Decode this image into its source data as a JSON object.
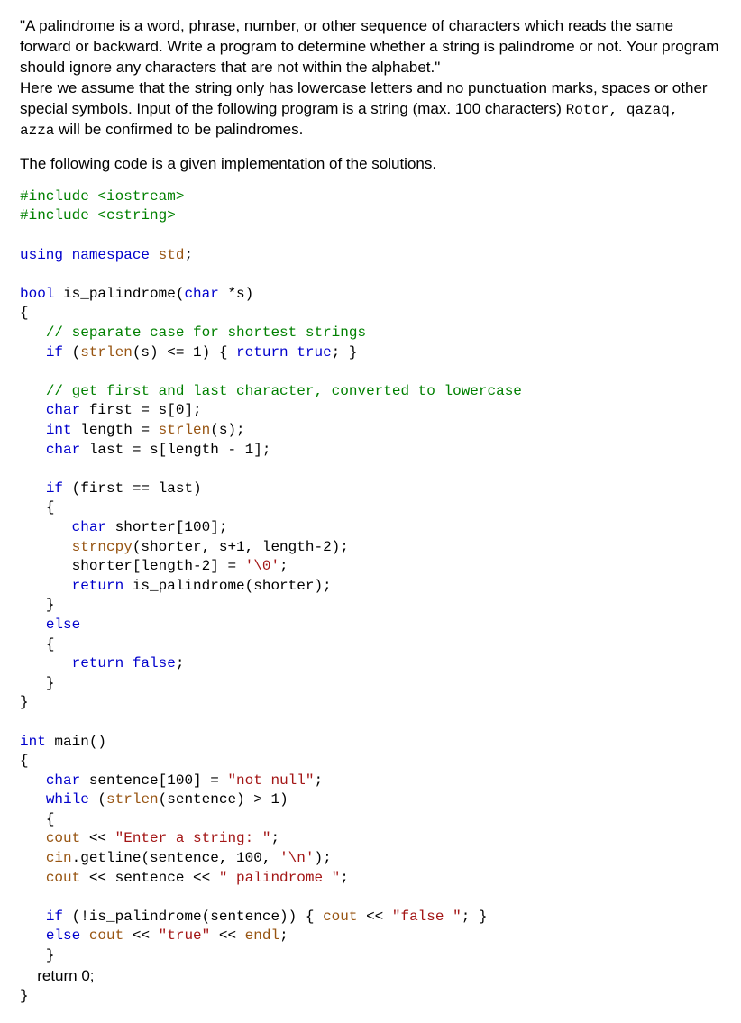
{
  "problem": {
    "quoted": "\"A palindrome is a word, phrase, number, or other sequence of characters which reads the same forward or backward. Write a program to determine whether a string is palindrome or not. Your program should ignore any characters that are not within the alphabet.\"",
    "assumption_pre": "Here we assume that the string only has lowercase letters and no punctuation marks, spaces or other special symbols.  Input of the following program is a string (max. 100 characters) ",
    "examples": "Rotor, qazaq, azza",
    "assumption_post": " will be confirmed to be palindromes.",
    "intro": "The following code is a given implementation of the solutions."
  },
  "code": {
    "inc1a": "#include ",
    "inc1b": "<iostream>",
    "inc2a": "#include ",
    "inc2b": "<cstring>",
    "using1": "using",
    "using2": " namespace ",
    "using3": "std",
    "using4": ";",
    "fn_bool": "bool",
    "fn_name": " is_palindrome",
    "fn_sig_a": "(",
    "fn_char": "char",
    "fn_sig_b": " *s)",
    "lb": "{",
    "rb": "}",
    "cmt1": "// separate case for shortest strings",
    "if1a": "if",
    "if1b": " (",
    "strlen": "strlen",
    "if1c": "(s) <= 1) { ",
    "ret": "return",
    "if1d": " ",
    "true": "true",
    "if1e": "; }",
    "cmt2": "// get first and last character, converted to lowercase",
    "l_char": "char",
    "l_first": " first = s[0];",
    "l_int": "int",
    "l_len_a": " length = ",
    "l_len_b": "(s);",
    "l_last": " last = s[length - 1];",
    "if2a": "if",
    "if2b": " (first == last)",
    "sh_decl": " shorter[100];",
    "strncpy": "strncpy",
    "sh_cpy": "(shorter, s+1, length-2);",
    "sh_term_a": "shorter[length-2] = ",
    "sh_term_b": "'\\0'",
    "sh_term_c": ";",
    "ret_rec_a": " is_palindrome(shorter);",
    "else": "else",
    "false": "false",
    "ret_false": ";",
    "main_int": "int",
    "main_name": " main",
    "main_par": "()",
    "sent_a": " sentence[100] = ",
    "sent_b": "\"not null\"",
    "sent_c": ";",
    "while": "while",
    "while_b": " (",
    "while_c": "(sentence) > 1)",
    "cout": "cout",
    "cin": "cin",
    "endl": "endl",
    "out1a": " << ",
    "out1b": "\"Enter a string: \"",
    "out1c": ";",
    "cin_a": ".getline(sentence, 100, ",
    "cin_b": "'\\n'",
    "cin_c": ");",
    "out2a": " << sentence << ",
    "out2b": "\" palindrome \"",
    "out2c": ";",
    "if3a": "if",
    "if3b": " (!is_palindrome(sentence)) { ",
    "out3a": " << ",
    "out3b": "\"false \"",
    "out3c": "; }",
    "else2": "else",
    "out4a": " << ",
    "out4b": "\"true\"",
    "out4c": " << ",
    "ret0": "return 0;"
  }
}
